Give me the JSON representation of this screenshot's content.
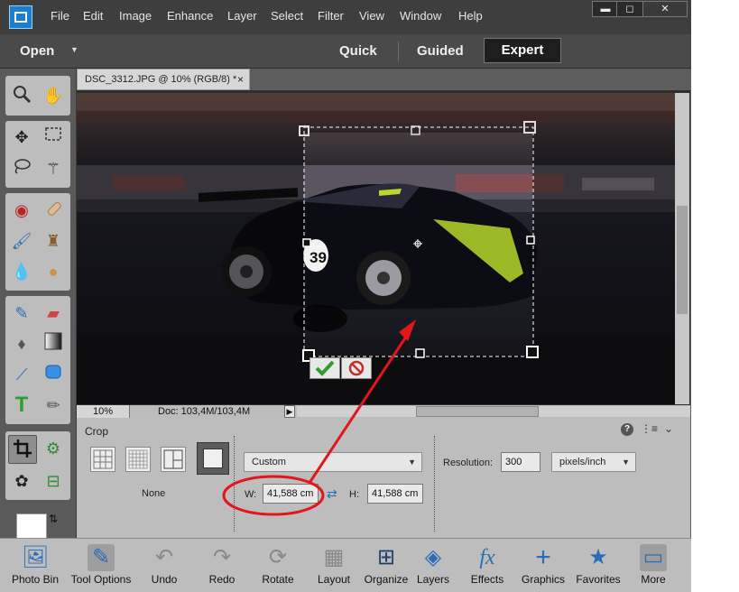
{
  "menu": [
    "File",
    "Edit",
    "Image",
    "Enhance",
    "Layer",
    "Select",
    "Filter",
    "View",
    "Window",
    "Help"
  ],
  "window_controls": {
    "minimize": "▬",
    "restore": "◻",
    "close": "✕"
  },
  "mode_bar": {
    "open_label": "Open",
    "modes": [
      "Quick",
      "Guided",
      "Expert"
    ],
    "active_mode": "Expert"
  },
  "document": {
    "tab_title": "DSC_3312.JPG @ 10% (RGB/8) *",
    "close": "×",
    "car_number": "39"
  },
  "status": {
    "zoom": "10%",
    "doc_size": "Doc: 103,4M/103,4M"
  },
  "tool_options": {
    "title": "Crop",
    "preset_label": "None",
    "aspect_dropdown": "Custom",
    "width_label": "W:",
    "width_value": "41,588 cm",
    "height_label": "H:",
    "height_value": "41,588 cm",
    "resolution_label": "Resolution:",
    "resolution_value": "300",
    "resolution_unit": "pixels/inch"
  },
  "taskbar": [
    "Photo Bin",
    "Tool Options",
    "Undo",
    "Redo",
    "Rotate",
    "Layout",
    "Organize",
    "Layers",
    "Effects",
    "Graphics",
    "Favorites",
    "More"
  ],
  "colors": {
    "accent": "#2a6fb6",
    "annotation": "#e3161b",
    "confirm": "#2e9e2e",
    "cancel": "#c0302a"
  }
}
